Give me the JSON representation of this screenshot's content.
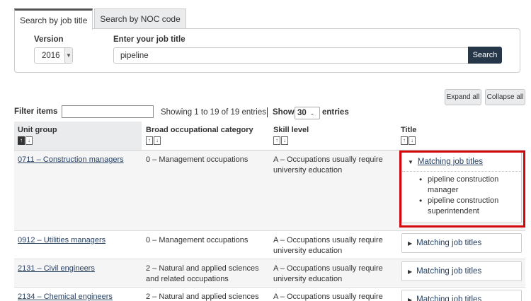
{
  "tabs": [
    {
      "label": "Search by job title",
      "active": true
    },
    {
      "label": "Search by NOC code",
      "active": false
    }
  ],
  "search": {
    "version_label": "Version",
    "version_value": "2016",
    "job_label": "Enter your job title",
    "job_value": "pipeline",
    "search_button": "Search"
  },
  "controls": {
    "expand_all": "Expand all",
    "collapse_all": "Collapse all",
    "filter_label": "Filter items",
    "showing_text": "Showing 1 to 19 of 19 entries",
    "show_label": "Show",
    "show_value": "30",
    "entries_label": "entries"
  },
  "table": {
    "headers": [
      "Unit group",
      "Broad occupational category",
      "Skill level",
      "Title"
    ],
    "rows": [
      {
        "unit_group": "0711 – Construction managers",
        "category": "0 – Management occupations",
        "skill": "A – Occupations usually require university education",
        "title_toggle": "Matching job titles",
        "expanded": true,
        "titles": [
          "pipeline construction manager",
          "pipeline construction superintendent"
        ]
      },
      {
        "unit_group": "0912 – Utilities managers",
        "category": "0 – Management occupations",
        "skill": "A – Occupations usually require university education",
        "title_toggle": "Matching job titles",
        "expanded": false
      },
      {
        "unit_group": "2131 – Civil engineers",
        "category": "2 – Natural and applied sciences and related occupations",
        "skill": "A – Occupations usually require university education",
        "title_toggle": "Matching job titles",
        "expanded": false
      },
      {
        "unit_group": "2134 – Chemical engineers",
        "category": "2 – Natural and applied sciences",
        "skill": "A – Occupations usually require",
        "title_toggle": "Matching job titles",
        "expanded": false
      }
    ]
  },
  "colors": {
    "search_button_bg": "#26374a",
    "link": "#284162",
    "highlight_border": "#d3080c"
  }
}
